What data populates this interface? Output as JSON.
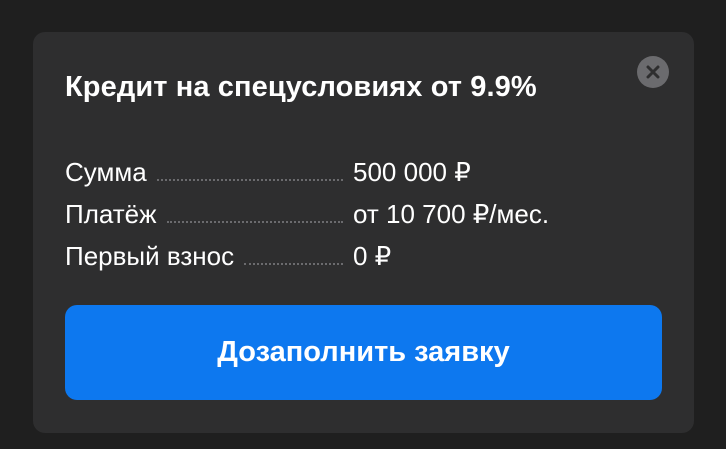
{
  "card": {
    "title": "Кредит на спецусловиях от 9.9%",
    "close_icon": "close-icon",
    "rows": [
      {
        "label": "Сумма",
        "value": "500 000 ₽"
      },
      {
        "label": "Платёж",
        "value": "от 10 700 ₽/мес."
      },
      {
        "label": "Первый взнос",
        "value": "0 ₽"
      }
    ],
    "cta_label": "Дозаполнить заявку"
  },
  "colors": {
    "page_background": "#1f1f1f",
    "card_background": "#2e2e2f",
    "accent": "#0d78ef",
    "close_button_bg": "#6b6b6e",
    "text": "#ffffff"
  }
}
